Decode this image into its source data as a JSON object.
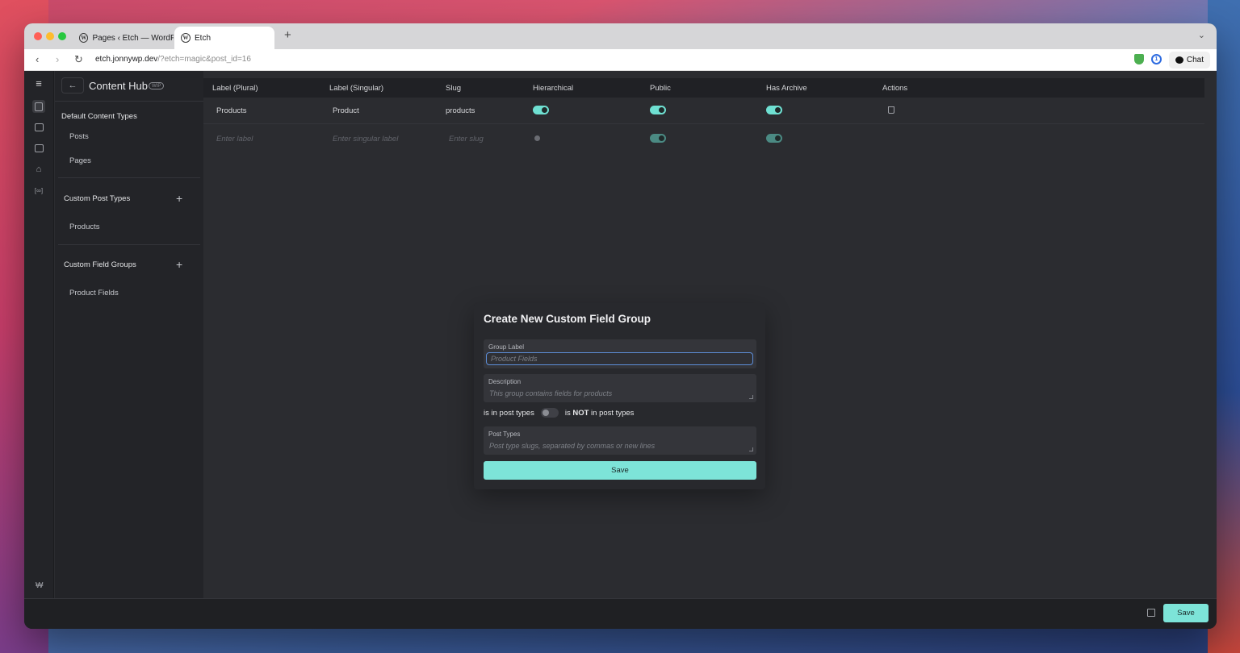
{
  "browser": {
    "tabs": [
      {
        "title": "Pages ‹ Etch — WordPr",
        "active": false
      },
      {
        "title": "Etch",
        "active": true
      }
    ],
    "url_domain": "etch.jonnywp.dev",
    "url_rest": "/?etch=magic&post_id=16",
    "chat_label": "Chat"
  },
  "sidebar": {
    "title": "Content Hub",
    "badge": "WIP",
    "sections": {
      "default": {
        "title": "Default Content Types",
        "items": [
          "Posts",
          "Pages"
        ]
      },
      "cpt": {
        "title": "Custom Post Types",
        "items": [
          "Products"
        ]
      },
      "cfg": {
        "title": "Custom Field Groups",
        "items": [
          "Product Fields"
        ]
      }
    }
  },
  "table": {
    "headers": [
      "Label (Plural)",
      "Label (Singular)",
      "Slug",
      "Hierarchical",
      "Public",
      "Has Archive",
      "Actions"
    ],
    "rows": [
      {
        "plural": "Products",
        "singular": "Product",
        "slug": "products",
        "hierarchical": true,
        "public": true,
        "has_archive": true
      }
    ],
    "new_row_placeholders": {
      "plural": "Enter label",
      "singular": "Enter singular label",
      "slug": "Enter slug"
    }
  },
  "modal": {
    "title": "Create New Custom Field Group",
    "group_label": {
      "label": "Group Label",
      "placeholder": "Product Fields"
    },
    "description": {
      "label": "Description",
      "placeholder": "This group contains fields for products"
    },
    "switch_left": "is in post types",
    "switch_right_prefix": "is ",
    "switch_right_bold": "NOT",
    "switch_right_suffix": " in post types",
    "post_types": {
      "label": "Post Types",
      "placeholder": "Post type slugs, separated by commas or new lines"
    },
    "save_label": "Save"
  },
  "footer": {
    "save_label": "Save"
  },
  "colors": {
    "accent": "#7de4d8",
    "background": "#2b2c30",
    "sidebar": "#232428"
  }
}
